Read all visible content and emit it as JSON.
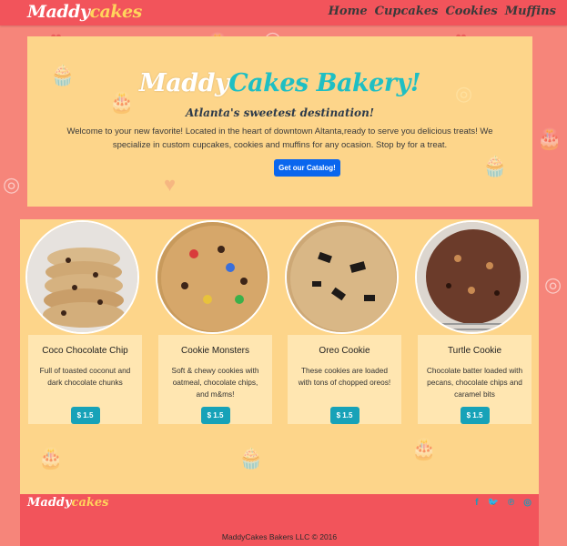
{
  "nav": {
    "brand_part1": "Maddy",
    "brand_part2": "cakes",
    "links": [
      "Home",
      "Cupcakes",
      "Cookies",
      "Muffins"
    ]
  },
  "hero": {
    "title_part1": "Maddy",
    "title_part2": "Cakes Bakery!",
    "subtitle": "Atlanta's sweetest destination!",
    "text": "Welcome to your new favorite! Located in the heart of downtown Altanta,ready to serve you delicious treats! We specialize in custom cupcakes, cookies and muffins for any ocasion. Stop by for a treat.",
    "button": "Get our Catalog!"
  },
  "products": [
    {
      "name": "Coco Chocolate Chip",
      "description": "Full of toasted coconut and dark chocolate chunks",
      "price": "$ 1.5"
    },
    {
      "name": "Cookie Monsters",
      "description": "Soft & chewy cookies with oatmeal, chocolate chips, and m&ms!",
      "price": "$ 1.5"
    },
    {
      "name": "Oreo Cookie",
      "description": "These cookies are loaded with tons of chopped oreos!",
      "price": "$ 1.5"
    },
    {
      "name": "Turtle Cookie",
      "description": "Chocolate batter loaded with pecans, chocolate chips and caramel bits",
      "price": "$ 1.5"
    }
  ],
  "footer": {
    "brand_part1": "Maddy",
    "brand_part2": "cakes",
    "social_icons": [
      "facebook-icon",
      "twitter-icon",
      "pinterest-icon",
      "instagram-icon"
    ],
    "copyright": "MaddyCakes Bakers LLC © 2016"
  },
  "colors": {
    "page_bg": "#f6857a",
    "navbar": "#f2545b",
    "panel": "#fdd58a",
    "accent_teal": "#1fbfc3",
    "accent_yellow": "#ffd45c",
    "primary_button": "#0a66ee",
    "price_button": "#17a2b8"
  }
}
